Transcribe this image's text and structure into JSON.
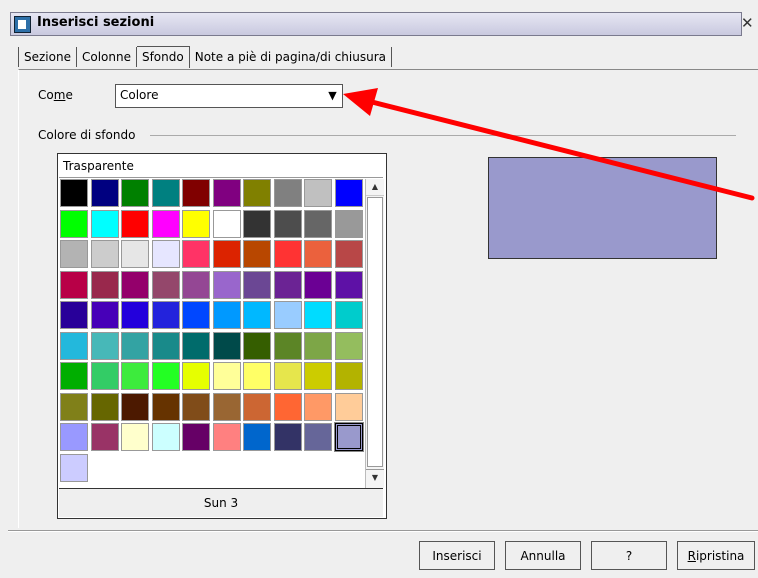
{
  "window": {
    "title": "Inserisci sezioni",
    "close_glyph": "✕"
  },
  "tabs": [
    {
      "label": "Sezione",
      "active": false
    },
    {
      "label": "Colonne",
      "active": false
    },
    {
      "label": "Sfondo",
      "active": true
    },
    {
      "label": "Note a piè di pagina/di chiusura",
      "active": false
    }
  ],
  "form": {
    "come_label_pre": "Co",
    "come_label_accel": "m",
    "come_label_post": "e",
    "come_value": "Colore",
    "dropdown_arrow": "▼"
  },
  "background": {
    "section_label": "Colore di sfondo",
    "transparent_label": "Trasparente",
    "selected_color_name": "Sun 3",
    "preview_color": "#9999cc",
    "palette": [
      [
        "#000000",
        "#000080",
        "#008000",
        "#008080",
        "#800000",
        "#800080",
        "#808000",
        "#808080",
        "#c0c0c0",
        "#0000ff"
      ],
      [
        "#00ff00",
        "#00ffff",
        "#ff0000",
        "#ff00ff",
        "#ffff00",
        "#ffffff",
        "#333333",
        "#4d4d4d",
        "#666666",
        "#999999"
      ],
      [
        "#b3b3b3",
        "#cccccc",
        "#e6e6e6",
        "#e6e6ff",
        "#ff3366",
        "#dc2300",
        "#b84700",
        "#ff3333",
        "#eb613d",
        "#b84747"
      ],
      [
        "#b80047",
        "#99284c",
        "#94006b",
        "#94476b",
        "#944794",
        "#9966cc",
        "#6b4794",
        "#6b2394",
        "#6b0094",
        "#5e11a6"
      ],
      [
        "#280099",
        "#4700b8",
        "#2300dc",
        "#2323dc",
        "#0047ff",
        "#0099ff",
        "#00b8ff",
        "#99ccff",
        "#00dcff",
        "#00cccc"
      ],
      [
        "#23b8dc",
        "#47b8b8",
        "#33a3a3",
        "#198a8a",
        "#006b6b",
        "#004a4a",
        "#355e00",
        "#5c8526",
        "#7da647",
        "#94bd5e"
      ],
      [
        "#00ae00",
        "#33cc66",
        "#3deb3d",
        "#23ff23",
        "#e6ff00",
        "#ffff99",
        "#ffff66",
        "#e6e64c",
        "#cccc00",
        "#b3b300"
      ],
      [
        "#808019",
        "#666600",
        "#4c1900",
        "#663300",
        "#804c19",
        "#996633",
        "#cc6633",
        "#ff6633",
        "#ff9966",
        "#ffcc99"
      ],
      [
        "#9999ff",
        "#993366",
        "#ffffcc",
        "#ccffff",
        "#660066",
        "#ff8080",
        "#0066cc",
        "#333366",
        "#666699",
        "#9999cc"
      ],
      [
        "#ccccff"
      ]
    ]
  },
  "buttons": {
    "insert": "Inserisci",
    "cancel": "Annulla",
    "help": "?",
    "reset_accel": "R",
    "reset_rest": "ipristina"
  },
  "annotation_color": "#ff0000"
}
